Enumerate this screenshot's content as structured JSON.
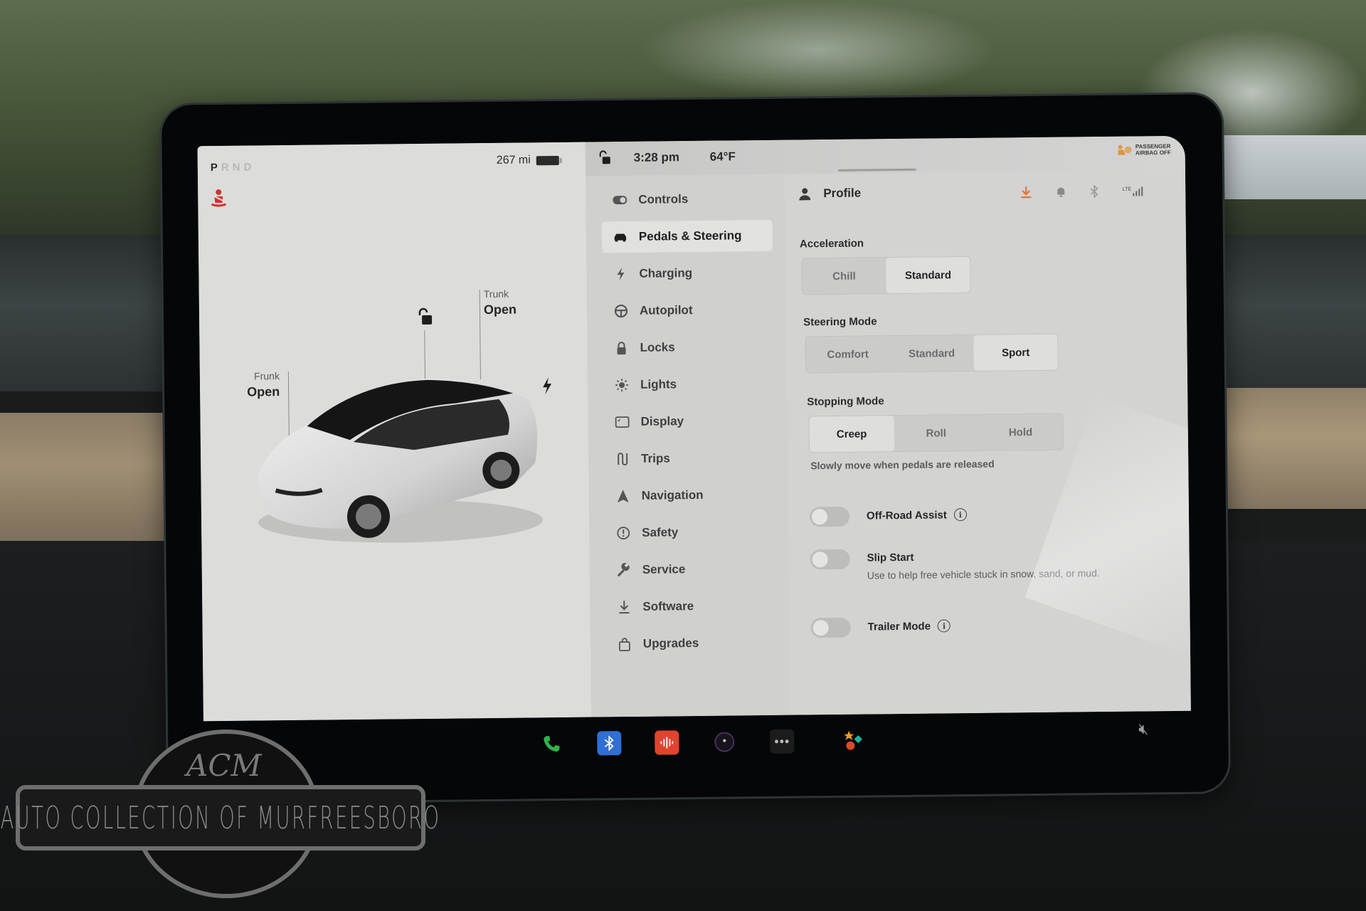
{
  "vehicle": {
    "gears": [
      {
        "label": "P",
        "selected": true
      },
      {
        "label": "R",
        "selected": false
      },
      {
        "label": "N",
        "selected": false
      },
      {
        "label": "D",
        "selected": false
      }
    ],
    "range": "267 mi",
    "frunk": {
      "label": "Frunk",
      "status": "Open"
    },
    "trunk": {
      "label": "Trunk",
      "status": "Open"
    }
  },
  "status_bar": {
    "time": "3:28 pm",
    "temperature": "64°F",
    "airbag_line1": "PASSENGER",
    "airbag_line2": "AIRBAG OFF",
    "connectivity": "LTE"
  },
  "menu": {
    "items": [
      {
        "label": "Controls",
        "icon": "toggle-icon",
        "active": false
      },
      {
        "label": "Pedals & Steering",
        "icon": "car-icon",
        "active": true
      },
      {
        "label": "Charging",
        "icon": "bolt-icon",
        "active": false
      },
      {
        "label": "Autopilot",
        "icon": "steering-wheel-icon",
        "active": false
      },
      {
        "label": "Locks",
        "icon": "lock-icon",
        "active": false
      },
      {
        "label": "Lights",
        "icon": "sun-icon",
        "active": false
      },
      {
        "label": "Display",
        "icon": "display-icon",
        "active": false
      },
      {
        "label": "Trips",
        "icon": "trips-icon",
        "active": false
      },
      {
        "label": "Navigation",
        "icon": "navigation-arrow-icon",
        "active": false
      },
      {
        "label": "Safety",
        "icon": "alert-circle-icon",
        "active": false
      },
      {
        "label": "Service",
        "icon": "wrench-icon",
        "active": false
      },
      {
        "label": "Software",
        "icon": "download-icon",
        "active": false
      },
      {
        "label": "Upgrades",
        "icon": "shopping-bag-icon",
        "active": false
      }
    ]
  },
  "content": {
    "profile_label": "Profile",
    "acceleration": {
      "title": "Acceleration",
      "options": [
        "Chill",
        "Standard"
      ],
      "selected": "Standard"
    },
    "steering": {
      "title": "Steering Mode",
      "options": [
        "Comfort",
        "Standard",
        "Sport"
      ],
      "selected": "Sport"
    },
    "stopping": {
      "title": "Stopping Mode",
      "options": [
        "Creep",
        "Roll",
        "Hold"
      ],
      "selected": "Creep",
      "hint": "Slowly move when pedals are released"
    },
    "toggles": [
      {
        "label": "Off-Road Assist",
        "description": "",
        "info": true,
        "on": false
      },
      {
        "label": "Slip Start",
        "description": "Use to help free vehicle stuck in snow, sand, or mud.",
        "info": false,
        "on": false
      },
      {
        "label": "Trailer Mode",
        "description": "",
        "info": true,
        "on": false
      }
    ]
  },
  "dock": {
    "items": [
      "phone-icon",
      "bluetooth-icon",
      "audio-icon",
      "camera-icon",
      "more-icon",
      "toybox-icon"
    ],
    "volume": "muted"
  },
  "colors": {
    "warning_red": "#d0312d",
    "download_orange": "#e07b39",
    "phone_green": "#2fb34a",
    "bluetooth_blue": "#2f6fd6",
    "audio_red": "#e0442f"
  },
  "watermark": {
    "monogram": "ACM",
    "text": "AUTO COLLECTION OF MURFREESBORO"
  }
}
